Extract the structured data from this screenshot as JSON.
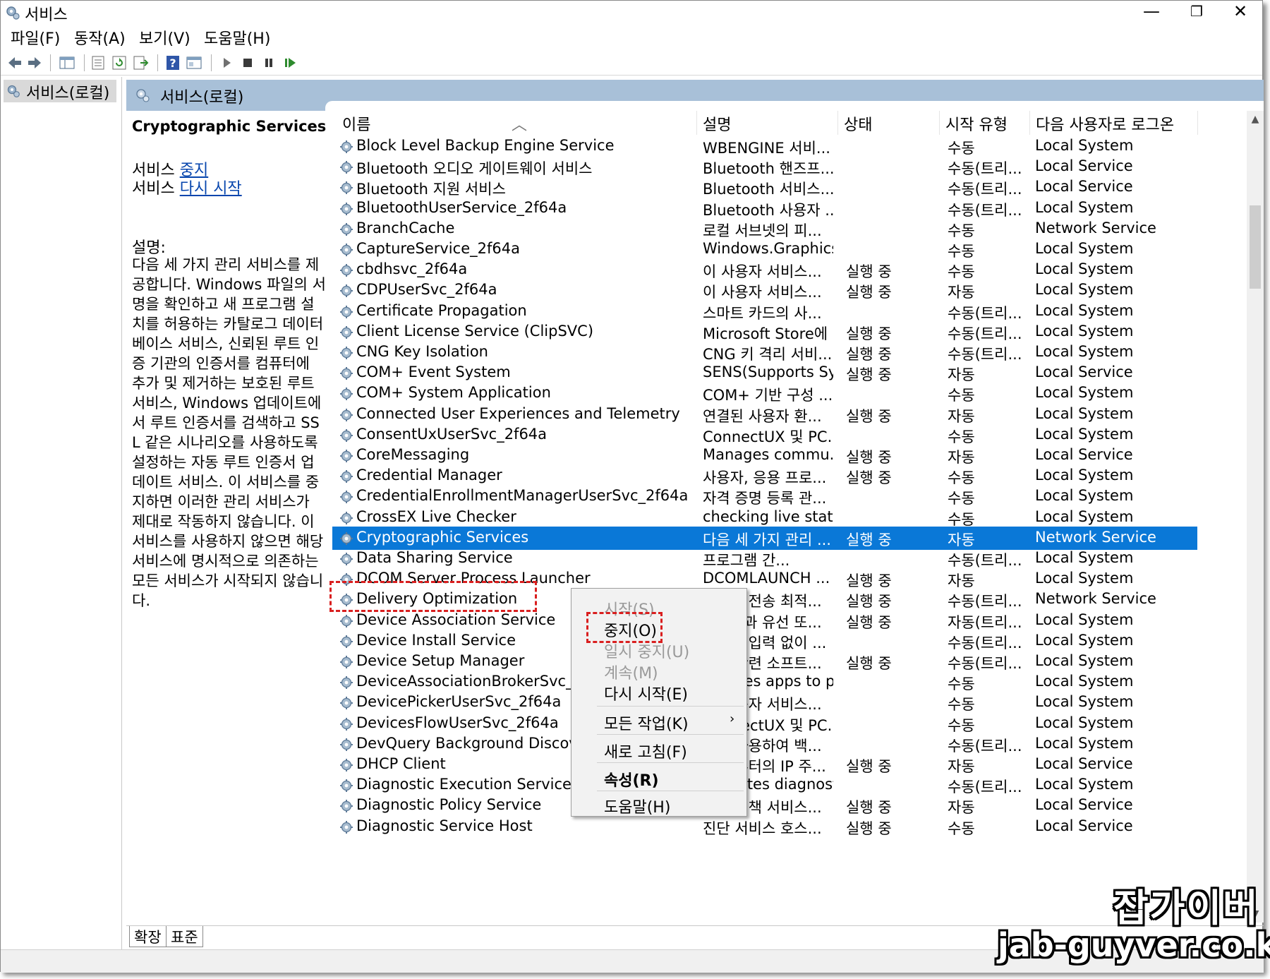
{
  "window": {
    "title": "서비스",
    "controls": {
      "minimize": "—",
      "maximize": "❐",
      "close": "✕"
    }
  },
  "menubar": [
    "파일(F)",
    "동작(A)",
    "보기(V)",
    "도움말(H)"
  ],
  "toolbar": {
    "icons": [
      "back-icon",
      "forward-icon",
      "show-hide-tree-icon",
      "properties-icon",
      "refresh-icon",
      "export-icon",
      "help-icon",
      "console-icon",
      "play-icon",
      "stop-icon",
      "pause-icon",
      "resume-icon"
    ]
  },
  "tree": {
    "root": "서비스(로컬)"
  },
  "pane_header": {
    "title": "서비스(로컬)"
  },
  "details": {
    "service_name": "Cryptographic Services",
    "action1_prefix": "서비스 ",
    "action1_link": "중지",
    "action2_prefix": "서비스 ",
    "action2_link": "다시 시작",
    "desc_label": "설명:",
    "description": "다음 세 가지 관리 서비스를 제공합니다. Windows 파일의 서명을 확인하고 새 프로그램 설치를 허용하는 카탈로그 데이터베이스 서비스, 신뢰된 루트 인증 기관의 인증서를 컴퓨터에 추가 및 제거하는 보호된 루트 서비스, Windows 업데이트에서 루트 인증서를 검색하고 SSL 같은 시나리오를 사용하도록 설정하는 자동 루트 인증서 업데이트 서비스. 이 서비스를 중지하면 이러한 관리 서비스가 제대로 작동하지 않습니다. 이 서비스를 사용하지 않으면 해당 서비스에 명시적으로 의존하는 모든 서비스가 시작되지 않습니다."
  },
  "columns": {
    "name": "이름",
    "description": "설명",
    "status": "상태",
    "startup": "시작 유형",
    "logon": "다음 사용자로 로그온"
  },
  "rows": [
    {
      "name": "Block Level Backup Engine Service",
      "desc": "WBENGINE 서비...",
      "state": "",
      "start": "수동",
      "logon": "Local System"
    },
    {
      "name": "Bluetooth 오디오 게이트웨이 서비스",
      "desc": "Bluetooth 핸즈프...",
      "state": "",
      "start": "수동(트리...",
      "logon": "Local Service"
    },
    {
      "name": "Bluetooth 지원 서비스",
      "desc": "Bluetooth 서비스...",
      "state": "",
      "start": "수동(트리...",
      "logon": "Local Service"
    },
    {
      "name": "BluetoothUserService_2f64a",
      "desc": "Bluetooth 사용자 ...",
      "state": "",
      "start": "수동(트리...",
      "logon": "Local System"
    },
    {
      "name": "BranchCache",
      "desc": "로컬 서브넷의 피...",
      "state": "",
      "start": "수동",
      "logon": "Network Service"
    },
    {
      "name": "CaptureService_2f64a",
      "desc": "Windows.Graphics...",
      "state": "",
      "start": "수동",
      "logon": "Local System"
    },
    {
      "name": "cbdhsvc_2f64a",
      "desc": "이 사용자 서비스...",
      "state": "실행 중",
      "start": "수동",
      "logon": "Local System"
    },
    {
      "name": "CDPUserSvc_2f64a",
      "desc": "이 사용자 서비스...",
      "state": "실행 중",
      "start": "자동",
      "logon": "Local System"
    },
    {
      "name": "Certificate Propagation",
      "desc": "스마트 카드의 사...",
      "state": "",
      "start": "수동(트리...",
      "logon": "Local System"
    },
    {
      "name": "Client License Service (ClipSVC)",
      "desc": "Microsoft Store에 ...",
      "state": "실행 중",
      "start": "수동(트리...",
      "logon": "Local System"
    },
    {
      "name": "CNG Key Isolation",
      "desc": "CNG 키 격리 서비...",
      "state": "실행 중",
      "start": "수동(트리...",
      "logon": "Local System"
    },
    {
      "name": "COM+ Event System",
      "desc": "SENS(Supports Sy...",
      "state": "실행 중",
      "start": "자동",
      "logon": "Local Service"
    },
    {
      "name": "COM+ System Application",
      "desc": "COM+ 기반 구성 ...",
      "state": "",
      "start": "수동",
      "logon": "Local System"
    },
    {
      "name": "Connected User Experiences and Telemetry",
      "desc": "연결된 사용자 환...",
      "state": "실행 중",
      "start": "자동",
      "logon": "Local System"
    },
    {
      "name": "ConsentUxUserSvc_2f64a",
      "desc": "ConnectUX 및 PC...",
      "state": "",
      "start": "수동",
      "logon": "Local System"
    },
    {
      "name": "CoreMessaging",
      "desc": "Manages commu...",
      "state": "실행 중",
      "start": "자동",
      "logon": "Local Service"
    },
    {
      "name": "Credential Manager",
      "desc": "사용자, 응용 프로...",
      "state": "실행 중",
      "start": "수동",
      "logon": "Local System"
    },
    {
      "name": "CredentialEnrollmentManagerUserSvc_2f64a",
      "desc": "자격 증명 등록 관...",
      "state": "",
      "start": "수동",
      "logon": "Local System"
    },
    {
      "name": "CrossEX Live Checker",
      "desc": "checking live stat...",
      "state": "",
      "start": "수동",
      "logon": "Local System"
    },
    {
      "name": "Cryptographic Services",
      "desc": "다음 세 가지 관리 ...",
      "state": "실행 중",
      "start": "자동",
      "logon": "Network Service",
      "selected": true
    },
    {
      "name": "Data Sharing Service",
      "desc": "프로그램 간...",
      "state": "",
      "start": "수동(트리...",
      "logon": "Local System"
    },
    {
      "name": "DCOM Server Process Launcher",
      "desc": "DCOMLAUNCH ...",
      "state": "실행 중",
      "start": "자동",
      "logon": "Local System"
    },
    {
      "name": "Delivery Optimization",
      "desc": "콘텐츠 전송 최적...",
      "state": "실행 중",
      "start": "수동(트리...",
      "logon": "Network Service"
    },
    {
      "name": "Device Association Service",
      "desc": "시스템과 유선 또...",
      "state": "실행 중",
      "start": "자동(트리...",
      "logon": "Local System"
    },
    {
      "name": "Device Install Service",
      "desc": "사용자 입력 없이 ...",
      "state": "",
      "start": "수동(트리...",
      "logon": "Local System"
    },
    {
      "name": "Device Setup Manager",
      "desc": "장치 관련 소프트...",
      "state": "실행 중",
      "start": "수동(트리...",
      "logon": "Local System"
    },
    {
      "name": "DeviceAssociationBrokerSvc_2f64a",
      "desc": "Enables apps to p...",
      "state": "",
      "start": "수동",
      "logon": "Local System"
    },
    {
      "name": "DevicePickerUserSvc_2f64a",
      "desc": "이 사용자 서비스...",
      "state": "",
      "start": "수동",
      "logon": "Local System"
    },
    {
      "name": "DevicesFlowUserSvc_2f64a",
      "desc": "ConnectUX 및 PC...",
      "state": "",
      "start": "수동",
      "logon": "Local System"
    },
    {
      "name": "DevQuery Background Discovery Broker",
      "desc": "앱을 사용하여 백...",
      "state": "",
      "start": "수동(트리...",
      "logon": "Local System"
    },
    {
      "name": "DHCP Client",
      "desc": "이 컴퓨터의 IP 주...",
      "state": "실행 중",
      "start": "자동",
      "logon": "Local Service"
    },
    {
      "name": "Diagnostic Execution Service",
      "desc": "Executes diagnost...",
      "state": "",
      "start": "수동(트리...",
      "logon": "Local System"
    },
    {
      "name": "Diagnostic Policy Service",
      "desc": "진단 정책 서비스...",
      "state": "실행 중",
      "start": "자동",
      "logon": "Local Service"
    },
    {
      "name": "Diagnostic Service Host",
      "desc": "진단 서비스 호스...",
      "state": "실행 중",
      "start": "수동",
      "logon": "Local Service"
    }
  ],
  "context_menu": {
    "start": "시작(S)",
    "stop": "중지(O)",
    "pause": "일시 중지(U)",
    "resume": "계속(M)",
    "restart": "다시 시작(E)",
    "all_tasks": "모든 작업(K)",
    "refresh": "새로 고침(F)",
    "properties": "속성(R)",
    "help": "도움말(H)"
  },
  "tabs": [
    "확장",
    "표준"
  ],
  "watermark": {
    "korean": "잡가이버",
    "url": "jab-guyver.co.kr"
  },
  "colors": {
    "selection": "#0a78d7",
    "header": "#a8c0d8",
    "highlight": "#d91f1f",
    "link": "#0645ad"
  }
}
